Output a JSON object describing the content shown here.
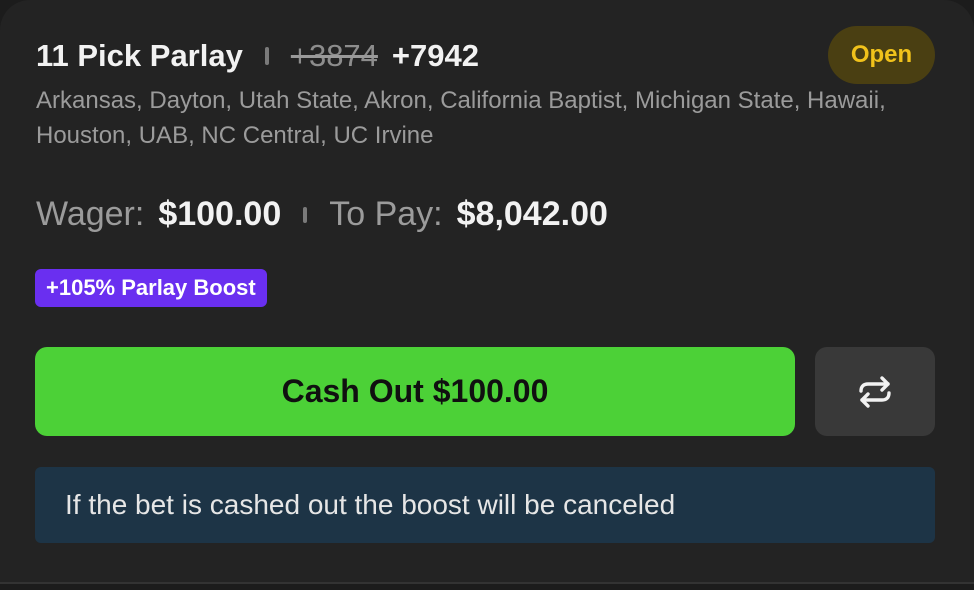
{
  "bet": {
    "title": "11 Pick Parlay",
    "old_odds": "+3874",
    "new_odds": "+7942",
    "status": "Open",
    "teams": "Arkansas, Dayton, Utah State, Akron, California Baptist, Michigan State, Hawaii, Houston, UAB, NC Central, UC Irvine"
  },
  "amounts": {
    "wager_label": "Wager:",
    "wager_value": "$100.00",
    "to_pay_label": "To Pay:",
    "to_pay_value": "$8,042.00"
  },
  "boost": {
    "label": "+105% Parlay Boost"
  },
  "actions": {
    "cashout_label": "Cash Out $100.00",
    "swap_icon": "swap-arrows-icon"
  },
  "notice": {
    "text": "If the bet is cashed out the boost will be canceled"
  },
  "colors": {
    "card_bg": "#232323",
    "cashout_green": "#4cd137",
    "boost_purple": "#6a2ff0",
    "status_yellow": "#f1c21b",
    "notice_bg": "#1d3446"
  }
}
